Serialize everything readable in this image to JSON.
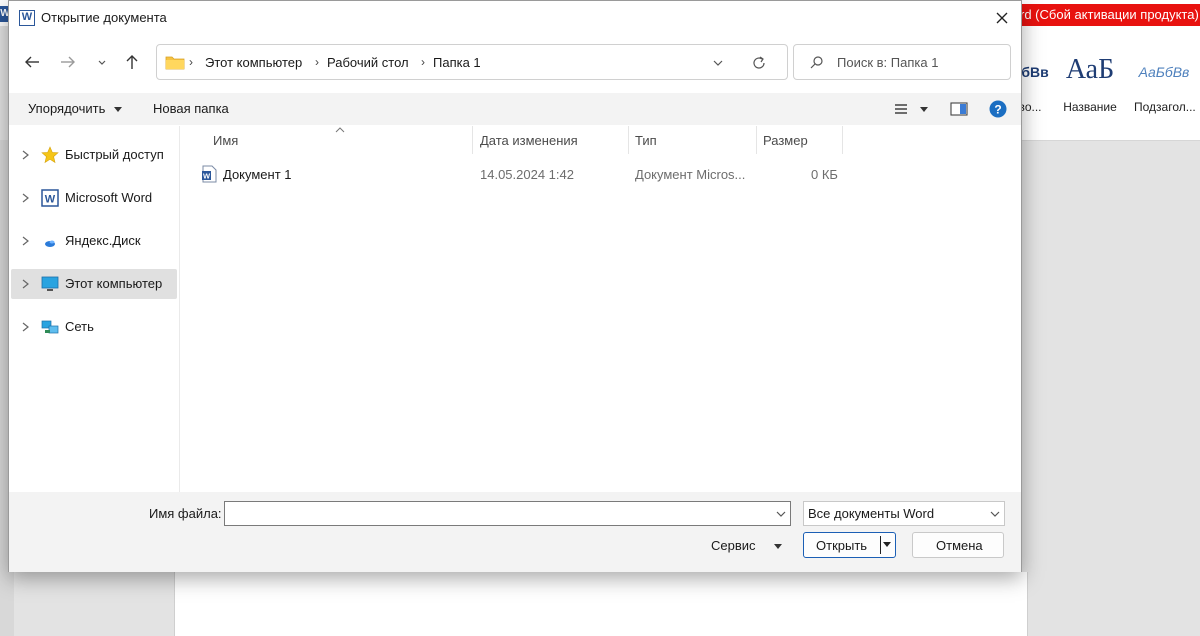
{
  "background_word": {
    "title_fragment": "rd (Сбой активации продукта)",
    "styles": [
      {
        "sample": "БбВв",
        "label": "вo..."
      },
      {
        "sample": "АаБ",
        "label": "Название"
      },
      {
        "sample": "АаБбВв",
        "label": "Подзагол..."
      }
    ],
    "accent_color": "#e8120f"
  },
  "dialog": {
    "title": "Открытие документа",
    "app_icon": "word-icon",
    "close_icon": "close-icon"
  },
  "nav": {
    "back_icon": "back-arrow-icon",
    "forward_icon": "forward-arrow-icon",
    "recent_icon": "chevron-down-icon",
    "up_icon": "up-arrow-icon",
    "breadcrumbs": [
      "Этот компьютер",
      "Рабочий стол",
      "Папка 1"
    ],
    "refresh_icon": "refresh-icon",
    "search_placeholder": "Поиск в: Папка 1"
  },
  "toolbar": {
    "organize_label": "Упорядочить",
    "new_folder_label": "Новая папка",
    "view_icon": "view-list-icon",
    "preview_icon": "preview-pane-icon",
    "help_icon": "help-icon"
  },
  "sidebar": {
    "items": [
      {
        "label": "Быстрый доступ",
        "icon": "star-icon",
        "selected": false
      },
      {
        "label": "Microsoft Word",
        "icon": "word-icon",
        "selected": false
      },
      {
        "label": "Яндекс.Диск",
        "icon": "yandex-disk-icon",
        "selected": false
      },
      {
        "label": "Этот компьютер",
        "icon": "computer-icon",
        "selected": true
      },
      {
        "label": "Сеть",
        "icon": "network-icon",
        "selected": false
      }
    ]
  },
  "filelist": {
    "columns": [
      "Имя",
      "Дата изменения",
      "Тип",
      "Размер"
    ],
    "rows": [
      {
        "name": "Документ 1",
        "date": "14.05.2024 1:42",
        "type": "Документ Micros...",
        "size": "0 КБ",
        "icon": "word-doc-icon"
      }
    ]
  },
  "bottom": {
    "filename_label": "Имя файла:",
    "filename_value": "",
    "filter_value": "Все документы Word",
    "service_label": "Сервис",
    "open_label": "Открыть",
    "cancel_label": "Отмена"
  }
}
